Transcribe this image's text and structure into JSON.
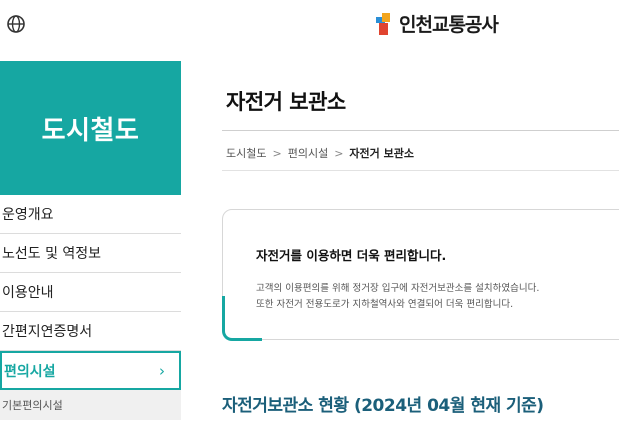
{
  "header": {
    "logo_text": "인천교통공사",
    "globe_icon": "globe-icon"
  },
  "sidebar": {
    "title": "도시철도",
    "accent_color": "#16a7a2",
    "items": [
      {
        "label": "운영개요"
      },
      {
        "label": "노선도 및 역정보"
      },
      {
        "label": "이용안내"
      },
      {
        "label": "간편지연증명서"
      },
      {
        "label": "편의시설",
        "active": true
      }
    ],
    "sub_items": [
      {
        "label": "기본편의시설"
      }
    ]
  },
  "main": {
    "title": "자전거 보관소",
    "breadcrumb": [
      "도시철도",
      "편의시설",
      "자전거 보관소"
    ],
    "notice": {
      "title": "자전거를 이용하면 더욱 편리합니다.",
      "line1": "고객의 이용편의를 위해 정거장 입구에 자전거보관소를 설치하였습니다.",
      "line2": "또한 자전거 전용도로가 지하철역사와 연결되어 더욱 편리합니다."
    },
    "section_title": "자전거보관소 현황 (2024년 04월 현재 기준)",
    "section_title_color": "#1b5f7a"
  }
}
